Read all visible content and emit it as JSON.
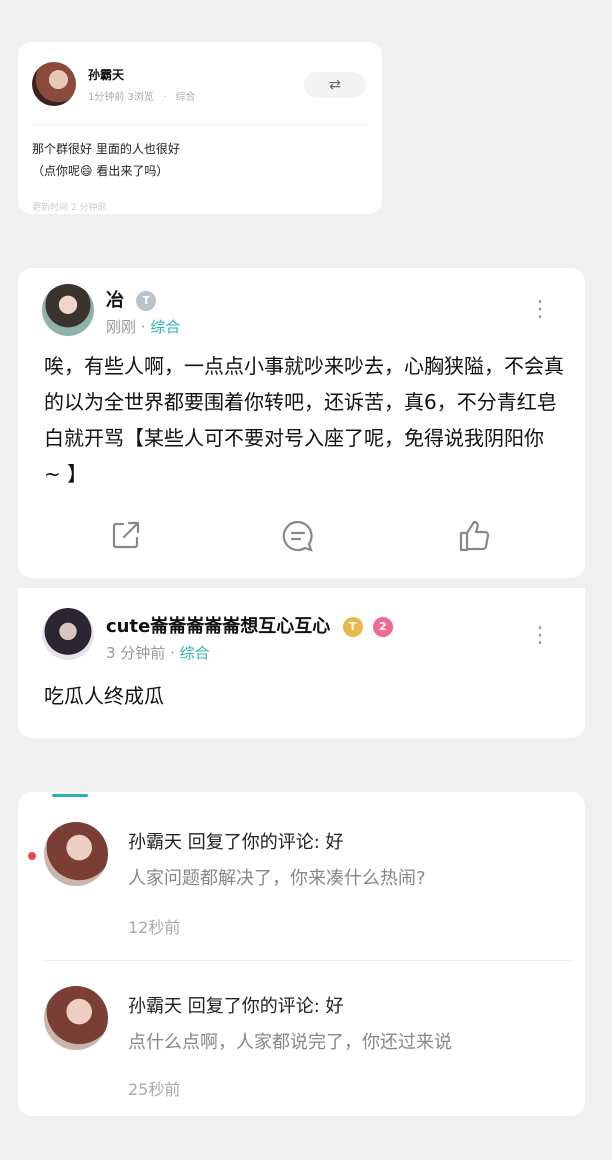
{
  "post_card": {
    "author": "孙霸天",
    "time": "1分钟前",
    "views": "3浏览",
    "category": "综合",
    "share_icon": "⇄",
    "body_line1": "那个群很好 里面的人也很好",
    "body_line2_a": "（点你呢",
    "emoji": "😄",
    "body_line2_b": " 看出来了吗）",
    "updated": "更新时间 2 分钟前"
  },
  "comment_1": {
    "author": "冶",
    "badge": "T",
    "time": "刚刚",
    "category": "综合",
    "text": "唉，有些人啊，一点点小事就吵来吵去，心胸狭隘，不会真的以为全世界都要围着你转吧，还诉苦，真6，不分青红皂白就开骂【某些人可不要对号入座了呢，免得说我阴阳你 ~ 】",
    "more": "⋮"
  },
  "comment_2": {
    "author": "cute崙崙崙崙崙想互心互心",
    "badge_t": "T",
    "badge_level": "2",
    "time": "3 分钟前",
    "category": "综合",
    "text": "吃瓜人终成瓜",
    "more": "⋮"
  },
  "notifications": [
    {
      "title": "孙霸天 回复了你的评论: 好",
      "reply": "人家问题都解决了，你来凑什么热闹?",
      "time": "12秒前"
    },
    {
      "title": "孙霸天 回复了你的评论: 好",
      "reply": "点什么点啊，人家都说完了，你还过来说",
      "time": "25秒前"
    }
  ],
  "colors": {
    "accent": "#2bb3b0",
    "unread": "#e54b4b",
    "badge_gold": "#e8b84a",
    "badge_pink": "#ef6b8f"
  }
}
